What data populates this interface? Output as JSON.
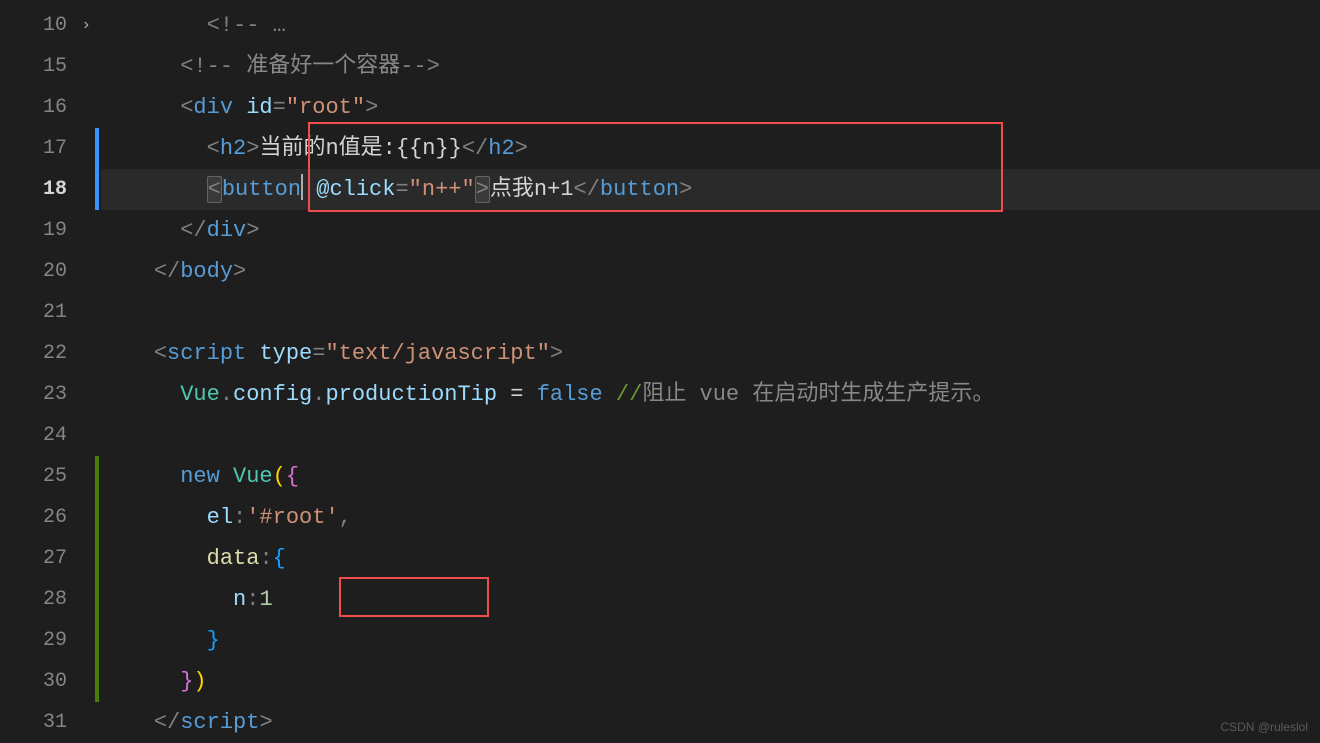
{
  "watermark": "CSDN @ruleslol",
  "lines": [
    {
      "num": 10,
      "fold": true
    },
    {
      "num": 15
    },
    {
      "num": 16
    },
    {
      "num": 17,
      "marker": "blue"
    },
    {
      "num": 18,
      "marker": "blue",
      "active": true
    },
    {
      "num": 19
    },
    {
      "num": 20
    },
    {
      "num": 21
    },
    {
      "num": 22
    },
    {
      "num": 23
    },
    {
      "num": 24
    },
    {
      "num": 25,
      "marker": "green"
    },
    {
      "num": 26,
      "marker": "green"
    },
    {
      "num": 27,
      "marker": "green"
    },
    {
      "num": 28,
      "marker": "green"
    },
    {
      "num": 29,
      "marker": "green"
    },
    {
      "num": 30,
      "marker": "green"
    },
    {
      "num": 31
    }
  ],
  "code": {
    "l10": {
      "comment_open": "<!--",
      "ellipsis": " …"
    },
    "l15": {
      "comment_open": "<!--",
      "comment_text": " 准备好一个容器",
      "comment_close": "-->"
    },
    "l16": {
      "tag": "div",
      "attr": "id",
      "val": "\"root\""
    },
    "l17": {
      "tag": "h2",
      "text1": "当前的n值是:",
      "expr": "{{n}}"
    },
    "l18": {
      "tag": "button",
      "attr": "@click",
      "val": "\"n++\"",
      "text": "点我n+1"
    },
    "l19": {
      "tag": "div"
    },
    "l20": {
      "tag": "body"
    },
    "l22": {
      "tag": "script",
      "attr": "type",
      "val": "\"text/javascript\""
    },
    "l23": {
      "obj": "Vue",
      "prop1": "config",
      "prop2": "productionTip",
      "op": " = ",
      "bool": "false",
      "comment": " //",
      "comment_text": "阻止 vue 在启动时生成生产提示。"
    },
    "l25": {
      "kw": "new",
      "cls": "Vue"
    },
    "l26": {
      "prop": "el",
      "val": "'#root'"
    },
    "l27": {
      "prop": "data"
    },
    "l28": {
      "prop": "n",
      "num": "1"
    },
    "l31": {
      "tag": "script"
    }
  }
}
